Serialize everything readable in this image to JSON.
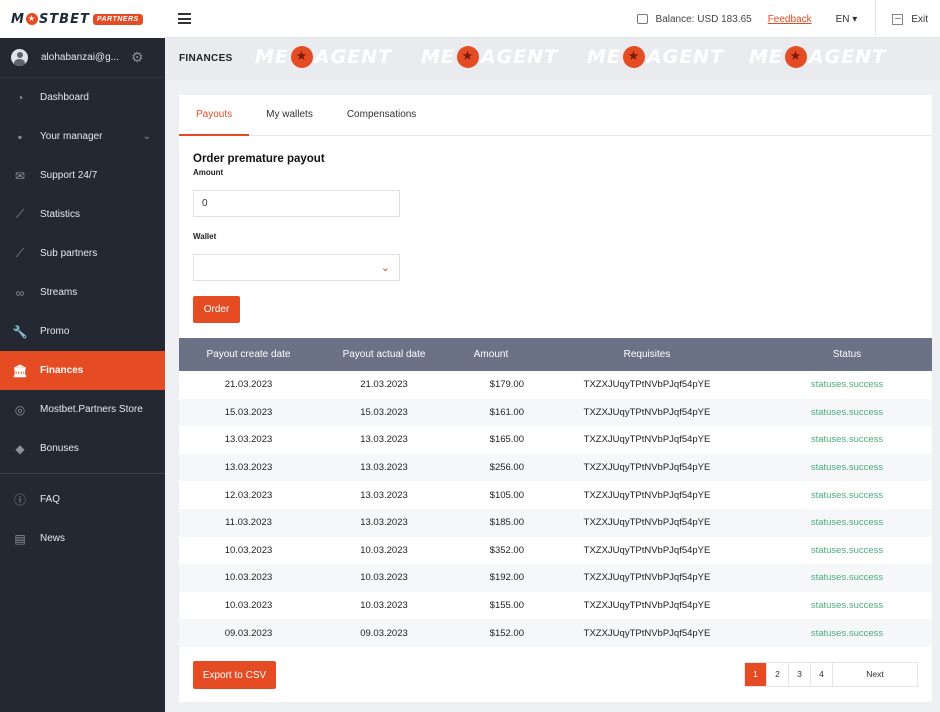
{
  "brand": {
    "name_left": "M",
    "name_right": "STBET",
    "badge": "PARTNERS",
    "accent": "#e64c24"
  },
  "topbar": {
    "balance": "Balance: USD 183.65",
    "feedback": "Feedback",
    "language": "EN ▾",
    "exit": "Exit"
  },
  "sidebar": {
    "user": "alohabanzai@g...",
    "items": [
      {
        "label": "Dashboard",
        "icon": "dashboard-icon",
        "glyph": "◔"
      },
      {
        "label": "Your manager",
        "icon": "manager-icon",
        "glyph": "▪",
        "chevron": "⌄"
      },
      {
        "label": "Support 24/7",
        "icon": "mail-icon",
        "glyph": "✉"
      },
      {
        "label": "Statistics",
        "icon": "chart-icon",
        "glyph": "⟋"
      },
      {
        "label": "Sub partners",
        "icon": "chart-icon",
        "glyph": "⟋"
      },
      {
        "label": "Streams",
        "icon": "link-icon",
        "glyph": "∞"
      },
      {
        "label": "Promo",
        "icon": "wrench-icon",
        "glyph": "🔧"
      },
      {
        "label": "Finances",
        "icon": "bank-icon",
        "glyph": "🏛"
      },
      {
        "label": "Mostbet.Partners Store",
        "icon": "store-icon",
        "glyph": "◎"
      },
      {
        "label": "Bonuses",
        "icon": "tag-icon",
        "glyph": "◆"
      }
    ],
    "bottom_items": [
      {
        "label": "FAQ",
        "icon": "info-icon",
        "glyph": "ⓘ"
      },
      {
        "label": "News",
        "icon": "news-icon",
        "glyph": "▤"
      }
    ]
  },
  "band": {
    "title": "FINANCES",
    "watermark_left": "ME",
    "watermark_right": "AGENT"
  },
  "tabs": [
    "Payouts",
    "My wallets",
    "Compensations"
  ],
  "form": {
    "title": "Order premature payout",
    "amount_label": "Amount",
    "amount_value": "0",
    "wallet_label": "Wallet",
    "order_button": "Order"
  },
  "table": {
    "headers": [
      "Payout create date",
      "Payout actual date",
      "Amount",
      "Requisites",
      "Status"
    ],
    "rows": [
      [
        "21.03.2023",
        "21.03.2023",
        "$179.00",
        "TXZXJUqyTPtNVbPJqf54pYE",
        "statuses.success"
      ],
      [
        "15.03.2023",
        "15.03.2023",
        "$161.00",
        "TXZXJUqyTPtNVbPJqf54pYE",
        "statuses.success"
      ],
      [
        "13.03.2023",
        "13.03.2023",
        "$165.00",
        "TXZXJUqyTPtNVbPJqf54pYE",
        "statuses.success"
      ],
      [
        "13.03.2023",
        "13.03.2023",
        "$256.00",
        "TXZXJUqyTPtNVbPJqf54pYE",
        "statuses.success"
      ],
      [
        "12.03.2023",
        "13.03.2023",
        "$105.00",
        "TXZXJUqyTPtNVbPJqf54pYE",
        "statuses.success"
      ],
      [
        "11.03.2023",
        "13.03.2023",
        "$185.00",
        "TXZXJUqyTPtNVbPJqf54pYE",
        "statuses.success"
      ],
      [
        "10.03.2023",
        "10.03.2023",
        "$352.00",
        "TXZXJUqyTPtNVbPJqf54pYE",
        "statuses.success"
      ],
      [
        "10.03.2023",
        "10.03.2023",
        "$192.00",
        "TXZXJUqyTPtNVbPJqf54pYE",
        "statuses.success"
      ],
      [
        "10.03.2023",
        "10.03.2023",
        "$155.00",
        "TXZXJUqyTPtNVbPJqf54pYE",
        "statuses.success"
      ],
      [
        "09.03.2023",
        "09.03.2023",
        "$152.00",
        "TXZXJUqyTPtNVbPJqf54pYE",
        "statuses.success"
      ]
    ]
  },
  "export_button": "Export to CSV",
  "pagination": {
    "pages": [
      "1",
      "2",
      "3",
      "4"
    ],
    "current": "1",
    "next": "Next"
  }
}
